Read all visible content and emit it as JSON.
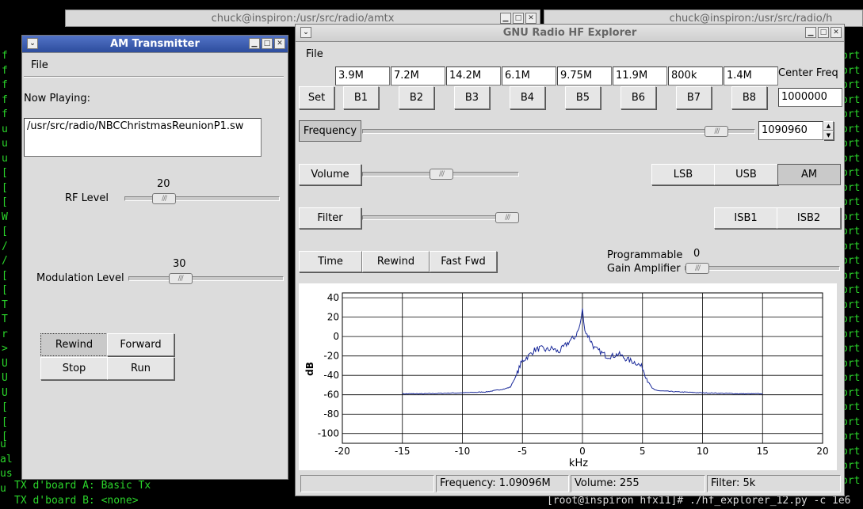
{
  "background": {
    "term1_title": "chuck@inspiron:/usr/src/radio/amtx",
    "term2_title": "chuck@inspiron:/usr/src/radio/h",
    "term_bottom_lines": [
      "TX d'board A: Basic Tx",
      "TX d'board B: <none>"
    ],
    "term_prompt": "[root@inspiron hfx11]# ./hf_explorer_12.py -c 1e6"
  },
  "am_window": {
    "title": "AM Transmitter",
    "menu_file": "File",
    "now_playing_label": "Now Playing:",
    "now_playing_value": "/usr/src/radio/NBCChristmasReunionP1.sw",
    "rf_level_label": "RF Level",
    "rf_level_value": "20",
    "modulation_label": "Modulation Level",
    "modulation_value": "30",
    "buttons": {
      "rewind": "Rewind",
      "forward": "Forward",
      "stop": "Stop",
      "run": "Run"
    },
    "rf_level_fraction": 0.25,
    "modulation_fraction": 0.33
  },
  "hf_window": {
    "title": "GNU Radio HF Explorer",
    "menu_file": "File",
    "presets": [
      "3.9M",
      "7.2M",
      "14.2M",
      "6.1M",
      "9.75M",
      "11.9M",
      "800k",
      "1.4M"
    ],
    "preset_buttons": [
      "B1",
      "B2",
      "B3",
      "B4",
      "B5",
      "B6",
      "B7",
      "B8"
    ],
    "set_label": "Set",
    "center_freq_label": "Center Freq",
    "center_freq_value": "1000000",
    "frequency_button": "Frequency",
    "frequency_value": "1090960",
    "frequency_fraction": 0.9,
    "volume_button": "Volume",
    "volume_fraction": 0.5,
    "filter_button": "Filter",
    "filter_fraction": 0.92,
    "mode_buttons": [
      "LSB",
      "USB",
      "AM"
    ],
    "isb_buttons": [
      "ISB1",
      "ISB2"
    ],
    "time_button": "Time",
    "rewind_button": "Rewind",
    "fastfwd_button": "Fast Fwd",
    "pga_label_line1": "Programmable",
    "pga_label_line2": "Gain Amplifier",
    "pga_value": "0",
    "pga_fraction": 0.0,
    "status": {
      "frequency": "Frequency: 1.09096M",
      "volume": "Volume: 255",
      "filter": "Filter: 5k"
    }
  },
  "chart_data": {
    "type": "line",
    "xlabel": "kHz",
    "ylabel": "dB",
    "xlim": [
      -20,
      20
    ],
    "ylim": [
      -110,
      45
    ],
    "xticks": [
      -20,
      -15,
      -10,
      -5,
      0,
      5,
      10,
      15,
      20
    ],
    "yticks": [
      40,
      20,
      0,
      -20,
      -40,
      -60,
      -80,
      -100
    ],
    "grid": true,
    "series": [
      {
        "color": "#1a2a9a",
        "x": [
          -15,
          -13.2,
          -10,
          -8,
          -6.5,
          -6,
          -5.8,
          -5.5,
          -5.2,
          -5,
          -4.5,
          -4,
          -3.5,
          -3,
          -2.5,
          -2,
          -1.5,
          -1,
          -0.6,
          -0.3,
          -0.1,
          0,
          0.1,
          0.3,
          0.6,
          1,
          1.5,
          2,
          2.5,
          3,
          3.5,
          4,
          4.5,
          5,
          5.2,
          5.5,
          5.8,
          6,
          6.5,
          8,
          10,
          13.2,
          15
        ],
        "y": [
          -59,
          -59,
          -58,
          -57,
          -54,
          -52,
          -47,
          -40,
          -30,
          -25,
          -20,
          -14,
          -12,
          -14,
          -12,
          -16,
          -10,
          -4,
          0,
          8,
          18,
          30,
          14,
          4,
          -2,
          -12,
          -16,
          -20,
          -20,
          -18,
          -22,
          -25,
          -27,
          -32,
          -38,
          -47,
          -53,
          -55,
          -56,
          -57,
          -58,
          -59,
          -59
        ]
      }
    ]
  }
}
